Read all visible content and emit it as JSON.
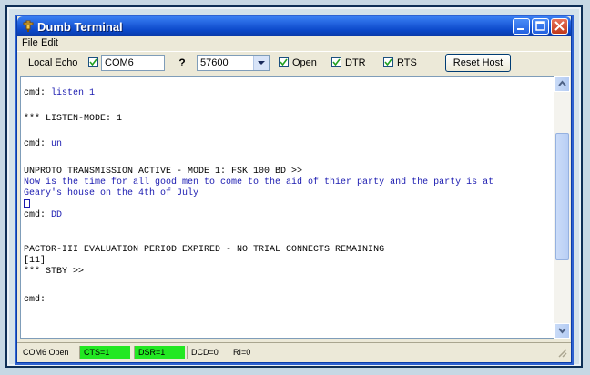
{
  "window": {
    "title": "Dumb Terminal"
  },
  "menu": [
    "File",
    "Edit"
  ],
  "toolbar": {
    "local_echo_label": "Local Echo",
    "port_value": "COM6",
    "help_label": "?",
    "baud_value": "57600",
    "open_label": "Open",
    "dtr_label": "DTR",
    "rts_label": "RTS",
    "reset_label": "Reset Host"
  },
  "terminal": {
    "line1_prompt": "cmd:",
    "line1_arg": "listen 1",
    "line2": "*** LISTEN-MODE: 1",
    "line3_prompt": "cmd:",
    "line3_arg": "un",
    "line4": "UNPROTO TRANSMISSION ACTIVE - MODE 1: FSK 100 BD >>",
    "line5": "Now is the time for all good men to come to the aid of thier party and the party is at",
    "line6": "Geary's house on the 4th of July",
    "line8_prompt": "cmd:",
    "line8_arg": "DD",
    "line9": "PACTOR-III EVALUATION PERIOD EXPIRED - NO TRIAL CONNECTS REMAINING",
    "line10": "[11]",
    "line11": "*** STBY >>",
    "line12_prompt": "cmd:"
  },
  "status": {
    "port_state": "COM6 Open",
    "cts": "CTS=1",
    "dsr": "DSR=1",
    "dcd": "DCD=0",
    "ri": "RI=0",
    "ok_color": "#22e822"
  }
}
